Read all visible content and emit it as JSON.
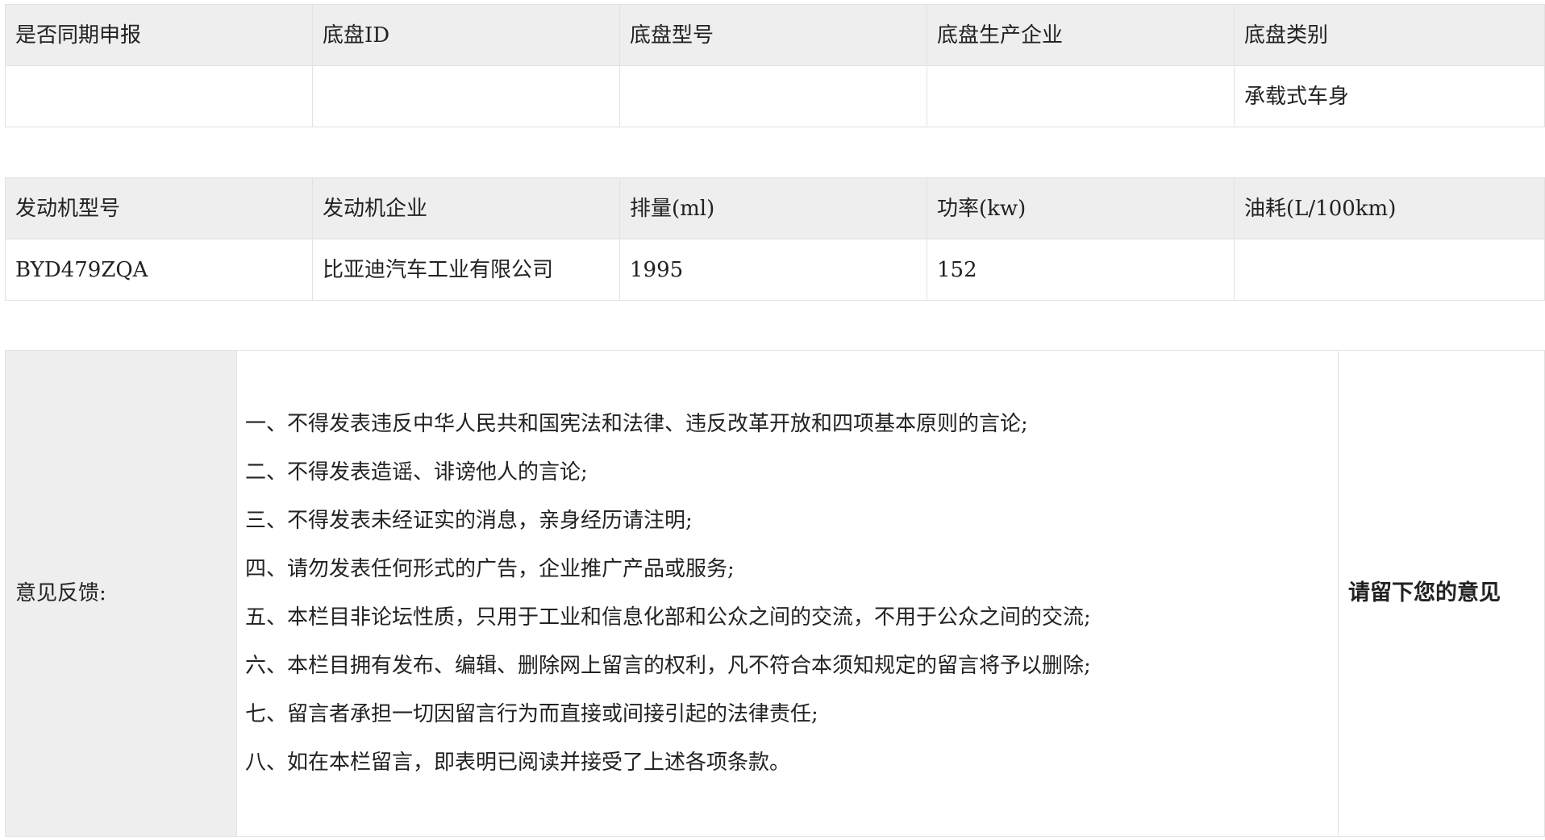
{
  "chassis": {
    "headers": [
      "是否同期申报",
      "底盘ID",
      "底盘型号",
      "底盘生产企业",
      "底盘类别"
    ],
    "values": [
      "",
      "",
      "",
      "",
      "承载式车身"
    ]
  },
  "engine": {
    "headers": [
      "发动机型号",
      "发动机企业",
      "排量(ml)",
      "功率(kw)",
      "油耗(L/100km)"
    ],
    "values": [
      "BYD479ZQA",
      "比亚迪汽车工业有限公司",
      "1995",
      "152",
      ""
    ]
  },
  "feedback": {
    "label": "意见反馈:",
    "rules": [
      "一、不得发表违反中华人民共和国宪法和法律、违反改革开放和四项基本原则的言论;",
      "二、不得发表造谣、诽谤他人的言论;",
      "三、不得发表未经证实的消息，亲身经历请注明;",
      "四、请勿发表任何形式的广告，企业推广产品或服务;",
      "五、本栏目非论坛性质，只用于工业和信息化部和公众之间的交流，不用于公众之间的交流;",
      "六、本栏目拥有发布、编辑、删除网上留言的权利，凡不符合本须知规定的留言将予以删除;",
      "七、留言者承担一切因留言行为而直接或间接引起的法律责任;",
      "八、如在本栏留言，即表明已阅读并接受了上述各项条款。"
    ],
    "action": "请留下您的意见"
  }
}
